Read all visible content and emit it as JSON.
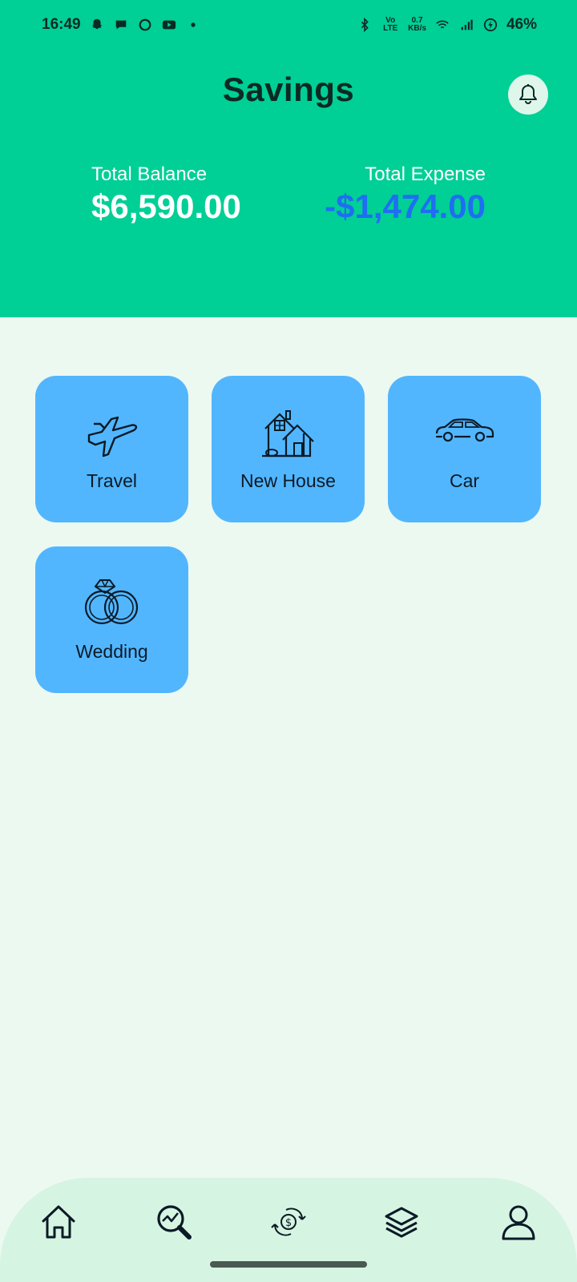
{
  "status_bar": {
    "time": "16:49",
    "volte_label": "Vo LTE",
    "net_speed_value": "0.7",
    "net_speed_unit": "KB/s",
    "battery": "46%"
  },
  "header": {
    "title": "Savings",
    "background_color": "#00cf96"
  },
  "summary": {
    "balance_label": "Total Balance",
    "balance_value": "$6,590.00",
    "expense_label": "Total Expense",
    "expense_value": "-$1,474.00",
    "expense_color": "#1f6ef2"
  },
  "categories": [
    {
      "label": "Travel",
      "icon": "airplane-icon"
    },
    {
      "label": "New House",
      "icon": "house-icon"
    },
    {
      "label": "Car",
      "icon": "car-icon"
    },
    {
      "label": "Wedding",
      "icon": "rings-icon"
    }
  ],
  "card_color": "#52b6ff",
  "bottom_nav": [
    {
      "icon": "home-icon"
    },
    {
      "icon": "analysis-icon"
    },
    {
      "icon": "transactions-icon"
    },
    {
      "icon": "layers-icon"
    },
    {
      "icon": "profile-icon"
    }
  ]
}
